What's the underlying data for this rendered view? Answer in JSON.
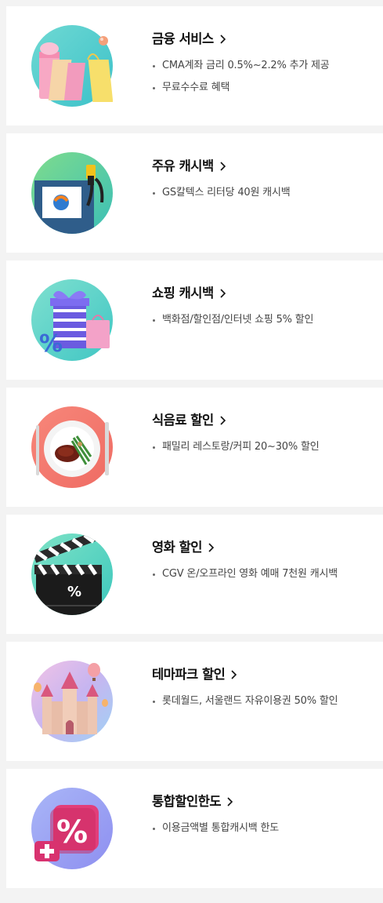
{
  "benefits": [
    {
      "title": "금융 서비스",
      "bullets": [
        "CMA계좌 금리 0.5%~2.2% 추가 제공",
        "무료수수료 혜택"
      ]
    },
    {
      "title": "주유 캐시백",
      "bullets": [
        "GS칼텍스 리터당 40원 캐시백"
      ]
    },
    {
      "title": "쇼핑 캐시백",
      "bullets": [
        "백화점/할인점/인터넷 쇼핑 5% 할인"
      ]
    },
    {
      "title": "식음료 할인",
      "bullets": [
        "패밀리 레스토랑/커피 20~30% 할인"
      ]
    },
    {
      "title": "영화 할인",
      "bullets": [
        "CGV 온/오프라인 영화 예매 7천원 캐시백"
      ]
    },
    {
      "title": "테마파크 할인",
      "bullets": [
        "롯데월드, 서울랜드 자유이용권 50% 할인"
      ]
    },
    {
      "title": "통합할인한도",
      "bullets": [
        "이용금액별 통합캐시백 한도"
      ]
    }
  ],
  "icons": {
    "finance": "shopping-bags-icon",
    "fuel": "gas-station-icon",
    "shopping": "gift-box-icon",
    "dining": "dinner-plate-icon",
    "movie": "clapperboard-icon",
    "themepark": "castle-icon",
    "total": "percent-badge-icon",
    "chevron": "chevron-right-icon"
  },
  "badge_text": {
    "percent": "%"
  }
}
